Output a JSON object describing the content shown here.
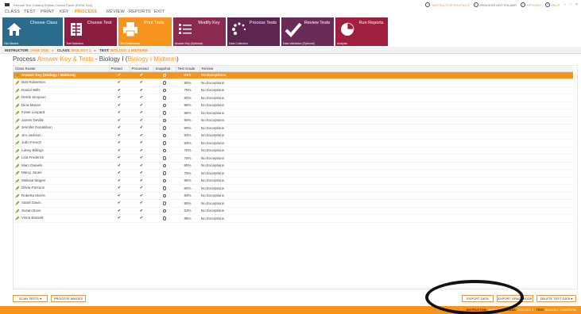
{
  "window": {
    "title": "Remark Test Grading Edition Control Panel (ESSA Tool)"
  },
  "menu": [
    "CLASS",
    "TEST",
    "PRINT",
    "KEY",
    "PROCESS",
    "REVIEW",
    "REPORTS",
    "EXIT"
  ],
  "active_menu": "PROCESS",
  "top_right": {
    "instructor_profiles": "INSTRUCTOR PROFILES",
    "process_hot_folder": "PROCESS HOT FOLDER",
    "options": "OPTIONS",
    "help": "HELP"
  },
  "ribbon": [
    {
      "label": "Choose Class",
      "sub": "Get Started",
      "color": "#2a6b8e"
    },
    {
      "label": "Choose Test",
      "sub": "Test Selection",
      "color": "#8b1d41"
    },
    {
      "label": "Print Tests",
      "sub": "Test Distribution",
      "color": "#f7941d"
    },
    {
      "label": "Modify Key",
      "sub": "Answer Key (Optional)",
      "color": "#8a2a4e"
    },
    {
      "label": "Process Tests",
      "sub": "Data Collection",
      "color": "#5c2550"
    },
    {
      "label": "Review Tests",
      "sub": "Data Validation (Optional)",
      "color": "#6a2c56"
    },
    {
      "label": "Run Reports",
      "sub": "Analysis",
      "color": "#a01f3e"
    }
  ],
  "crumbs": {
    "instructor_label": "INSTRUCTOR:",
    "instructor": "JANE DOE",
    "class_label": "CLASS:",
    "class": "BIOLOGY 1",
    "test_label": "TEST:",
    "test": "BIOLOGY 1 MIDTERM"
  },
  "heading": {
    "prefix": "Process",
    "highlight": "Answer Key & Tests",
    "dash": " - Biology I (",
    "paren": "Biology I Midterm",
    "close": ")"
  },
  "table": {
    "headers": [
      "Class Roster",
      "Printed",
      "Processed",
      "Snapshot",
      "Test Grade",
      "Review"
    ],
    "rows": [
      {
        "name": "Answer Key (Biology I Midterm)",
        "grade": "KEY",
        "review": "No Exceptions",
        "highlight": true
      },
      {
        "name": "Bob Robertson",
        "grade": "90%",
        "review": "No Exceptions"
      },
      {
        "name": "Daniel Wills",
        "grade": "75%",
        "review": "No Exceptions"
      },
      {
        "name": "Derek Simpson",
        "grade": "80%",
        "review": "No Exceptions"
      },
      {
        "name": "Dina Mason",
        "grade": "88%",
        "review": "No Exceptions"
      },
      {
        "name": "Frank Leopard",
        "grade": "98%",
        "review": "No Exceptions"
      },
      {
        "name": "James Deville",
        "grade": "90%",
        "review": "No Exceptions"
      },
      {
        "name": "Jennifer Donaldson",
        "grade": "90%",
        "review": "No Exceptions"
      },
      {
        "name": "Jim Jackson",
        "grade": "93%",
        "review": "No Exceptions"
      },
      {
        "name": "John French",
        "grade": "83%",
        "review": "No Exceptions"
      },
      {
        "name": "Laney Billings",
        "grade": "75%",
        "review": "No Exceptions"
      },
      {
        "name": "Lisa Frederick",
        "grade": "75%",
        "review": "No Exceptions"
      },
      {
        "name": "Marc Daniels",
        "grade": "80%",
        "review": "No Exceptions"
      },
      {
        "name": "Marcy Jones",
        "grade": "75%",
        "review": "No Exceptions"
      },
      {
        "name": "Melissa Magee",
        "grade": "95%",
        "review": "No Exceptions"
      },
      {
        "name": "Olivia Parsons",
        "grade": "60%",
        "review": "No Exceptions"
      },
      {
        "name": "Roberta Morris",
        "grade": "83%",
        "review": "No Exceptions"
      },
      {
        "name": "Sarah Davis",
        "grade": "90%",
        "review": "No Exceptions"
      },
      {
        "name": "Susan Dove",
        "grade": "53%",
        "review": "No Exceptions"
      },
      {
        "name": "Vince Bassett",
        "grade": "88%",
        "review": "No Exceptions"
      }
    ]
  },
  "buttons": {
    "scan_tests": "SCAN TESTS",
    "process_images": "PROCESS IMAGES",
    "export_data": "EXPORT DATA",
    "export_gradebook": "EXPORT GRADEBOOK",
    "delete_test_data": "DELETE TEST DATA"
  },
  "footer": {
    "instructor_label": "INSTRUCTOR:",
    "instructor": "JANE DOE",
    "class_label": "CLASS:",
    "class": "BIOLOGY 1",
    "test_label": "TEST:",
    "test": "BIOLOGY 1 MIDTERM"
  },
  "colors": {
    "accent": "#f7941d",
    "highlight_row": "#f7941d",
    "text": "#333333"
  }
}
